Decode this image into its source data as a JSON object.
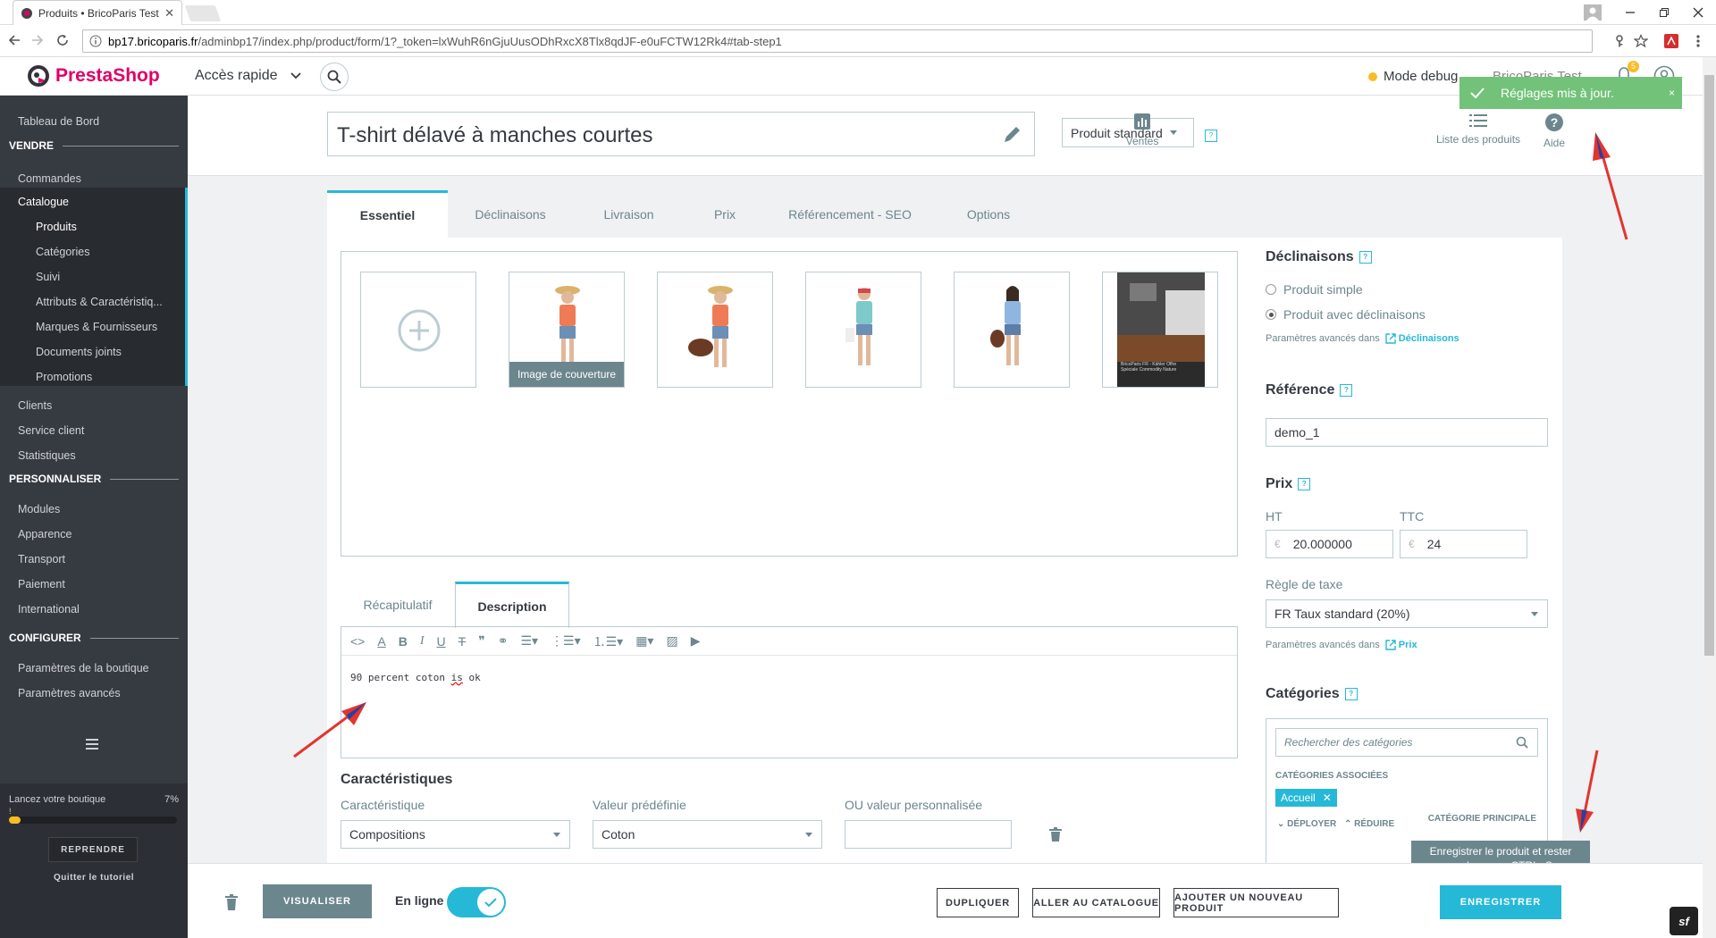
{
  "browser": {
    "tab_title": "Produits • BricoParis Test",
    "url_host": "bp17.bricoparis.fr",
    "url_path": "/adminbp17/index.php/product/form/1?_token=lxWuhR6nGjuUusODhRxcX8Tlx8qdJF-e0uFCTW12Rk4#tab-step1"
  },
  "header": {
    "logo": "PrestaShop",
    "quick_access": "Accès rapide",
    "debug_mode": "Mode debug",
    "shop_name": "BricoParis Test",
    "notif_count": "5"
  },
  "sidebar": {
    "dashboard": "Tableau de Bord",
    "sell": "VENDRE",
    "orders": "Commandes",
    "catalog": "Catalogue",
    "catalog_items": [
      "Produits",
      "Catégories",
      "Suivi",
      "Attributs & Caractéristiq...",
      "Marques & Fournisseurs",
      "Documents joints",
      "Promotions"
    ],
    "customers": "Clients",
    "service": "Service client",
    "stats": "Statistiques",
    "customize": "PERSONNALISER",
    "customize_items": [
      "Modules",
      "Apparence",
      "Transport",
      "Paiement",
      "International"
    ],
    "configure": "CONFIGURER",
    "configure_items": [
      "Paramètres de la boutique",
      "Paramètres avancés"
    ],
    "tutorial_label": "Lancez votre boutique",
    "tutorial_pct": "7%",
    "tutorial_progress": 0.07,
    "tutorial_mark": "!",
    "resume": "REPRENDRE",
    "quit": "Quitter le tutoriel"
  },
  "product": {
    "name": "T-shirt délavé à manches courtes",
    "type": "Produit standard",
    "help": "?"
  },
  "toolbar": {
    "sales": "Ventes",
    "product_list": "Liste des produits",
    "help": "Aide"
  },
  "toast": {
    "message": "Réglages mis à jour.",
    "close": "×"
  },
  "tabs": [
    "Essentiel",
    "Déclinaisons",
    "Livraison",
    "Prix",
    "Référencement - SEO",
    "Options"
  ],
  "images": {
    "cover_label": "Image de couverture",
    "banner_text": "BricoParis FR - Kähler Offre Spéciale Commodity Nature"
  },
  "subtabs": [
    "Récapitulatif",
    "Description"
  ],
  "description": {
    "text_before": "90 percent coton ",
    "text_spell": "is",
    "text_after": " ok"
  },
  "features": {
    "title": "Caractéristiques",
    "label_feature": "Caractéristique",
    "label_value": "Valeur prédéfinie",
    "label_custom": "OU valeur personnalisée",
    "feature_value": "Compositions",
    "predefined_value": "Coton",
    "custom_value": ""
  },
  "combinations": {
    "title": "Déclinaisons",
    "simple": "Produit simple",
    "with_combinations": "Produit avec déclinaisons",
    "adv_text": "Paramètres avancés dans",
    "adv_link": "Déclinaisons"
  },
  "reference": {
    "title": "Référence",
    "value": "demo_1"
  },
  "price": {
    "title": "Prix",
    "ht_label": "HT",
    "ttc_label": "TTC",
    "currency": "€",
    "ht_value": "20.000000",
    "ttc_value": "24",
    "tax_label": "Règle de taxe",
    "tax_value": "FR Taux standard (20%)",
    "adv_text": "Paramètres avancés dans",
    "adv_link": "Prix"
  },
  "categories": {
    "title": "Catégories",
    "search_placeholder": "Rechercher des catégories",
    "associated": "CATÉGORIES ASSOCIÉES",
    "tag": "Accueil",
    "expand": "DÉPLOYER",
    "collapse": "RÉDUIRE",
    "main_category": "CATÉGORIE PRINCIPALE"
  },
  "footer": {
    "view": "VISUALISER",
    "online": "En ligne",
    "duplicate": "DUPLIQUER",
    "go_catalog": "ALLER AU CATALOGUE",
    "add_new": "AJOUTER UN NOUVEAU PRODUIT",
    "save": "ENREGISTRER",
    "tooltip_line1": "Enregistrer le produit et rester",
    "tooltip_line2": "sur la page : CTRL+S"
  },
  "colors": {
    "accent": "#25b9d7",
    "sidebar": "#363a41",
    "success": "#72c279",
    "brand": "#df0067"
  }
}
